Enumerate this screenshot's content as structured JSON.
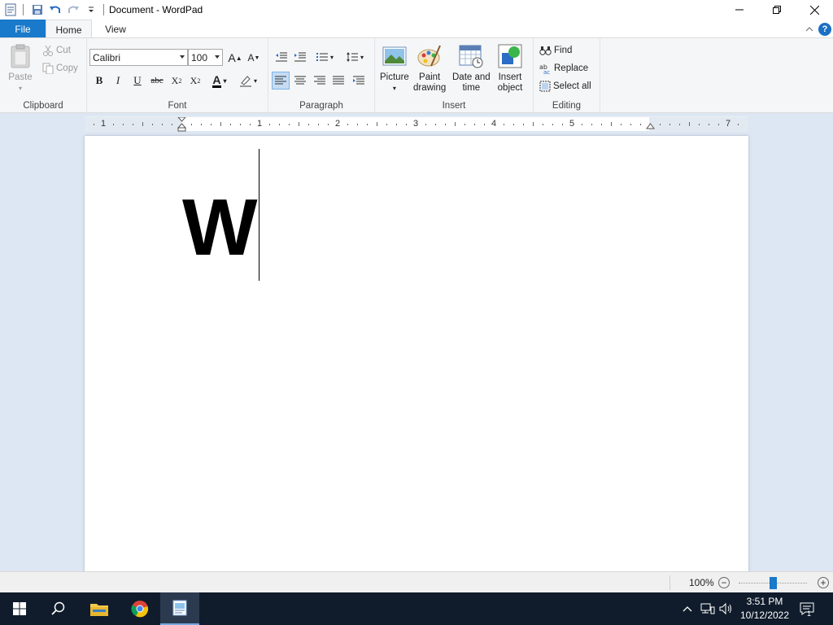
{
  "window": {
    "title": "Document - WordPad"
  },
  "tabs": {
    "file": "File",
    "home": "Home",
    "view": "View"
  },
  "clipboard": {
    "paste": "Paste",
    "cut": "Cut",
    "copy": "Copy",
    "label": "Clipboard"
  },
  "font": {
    "family": "Calibri",
    "size": "100",
    "label": "Font"
  },
  "paragraph": {
    "label": "Paragraph"
  },
  "insert": {
    "picture": "Picture",
    "paint_drawing": "Paint drawing",
    "paint_line1": "Paint",
    "paint_line2": "drawing",
    "datetime_line1": "Date and",
    "datetime_line2": "time",
    "object_line1": "Insert",
    "object_line2": "object",
    "label": "Insert"
  },
  "editing": {
    "find": "Find",
    "replace": "Replace",
    "select_all": "Select all",
    "label": "Editing"
  },
  "ruler": {
    "numbers": [
      "1",
      "1",
      "2",
      "3",
      "4",
      "5",
      "7"
    ]
  },
  "document": {
    "text": "W"
  },
  "status": {
    "zoom": "100%"
  },
  "taskbar": {
    "time": "3:51 PM",
    "date": "10/12/2022",
    "notification_count": "1"
  },
  "colors": {
    "file_tab": "#1979ca",
    "taskbar": "#101c2c",
    "workspace": "#dde7f3",
    "ribbon": "#f5f6f7"
  }
}
